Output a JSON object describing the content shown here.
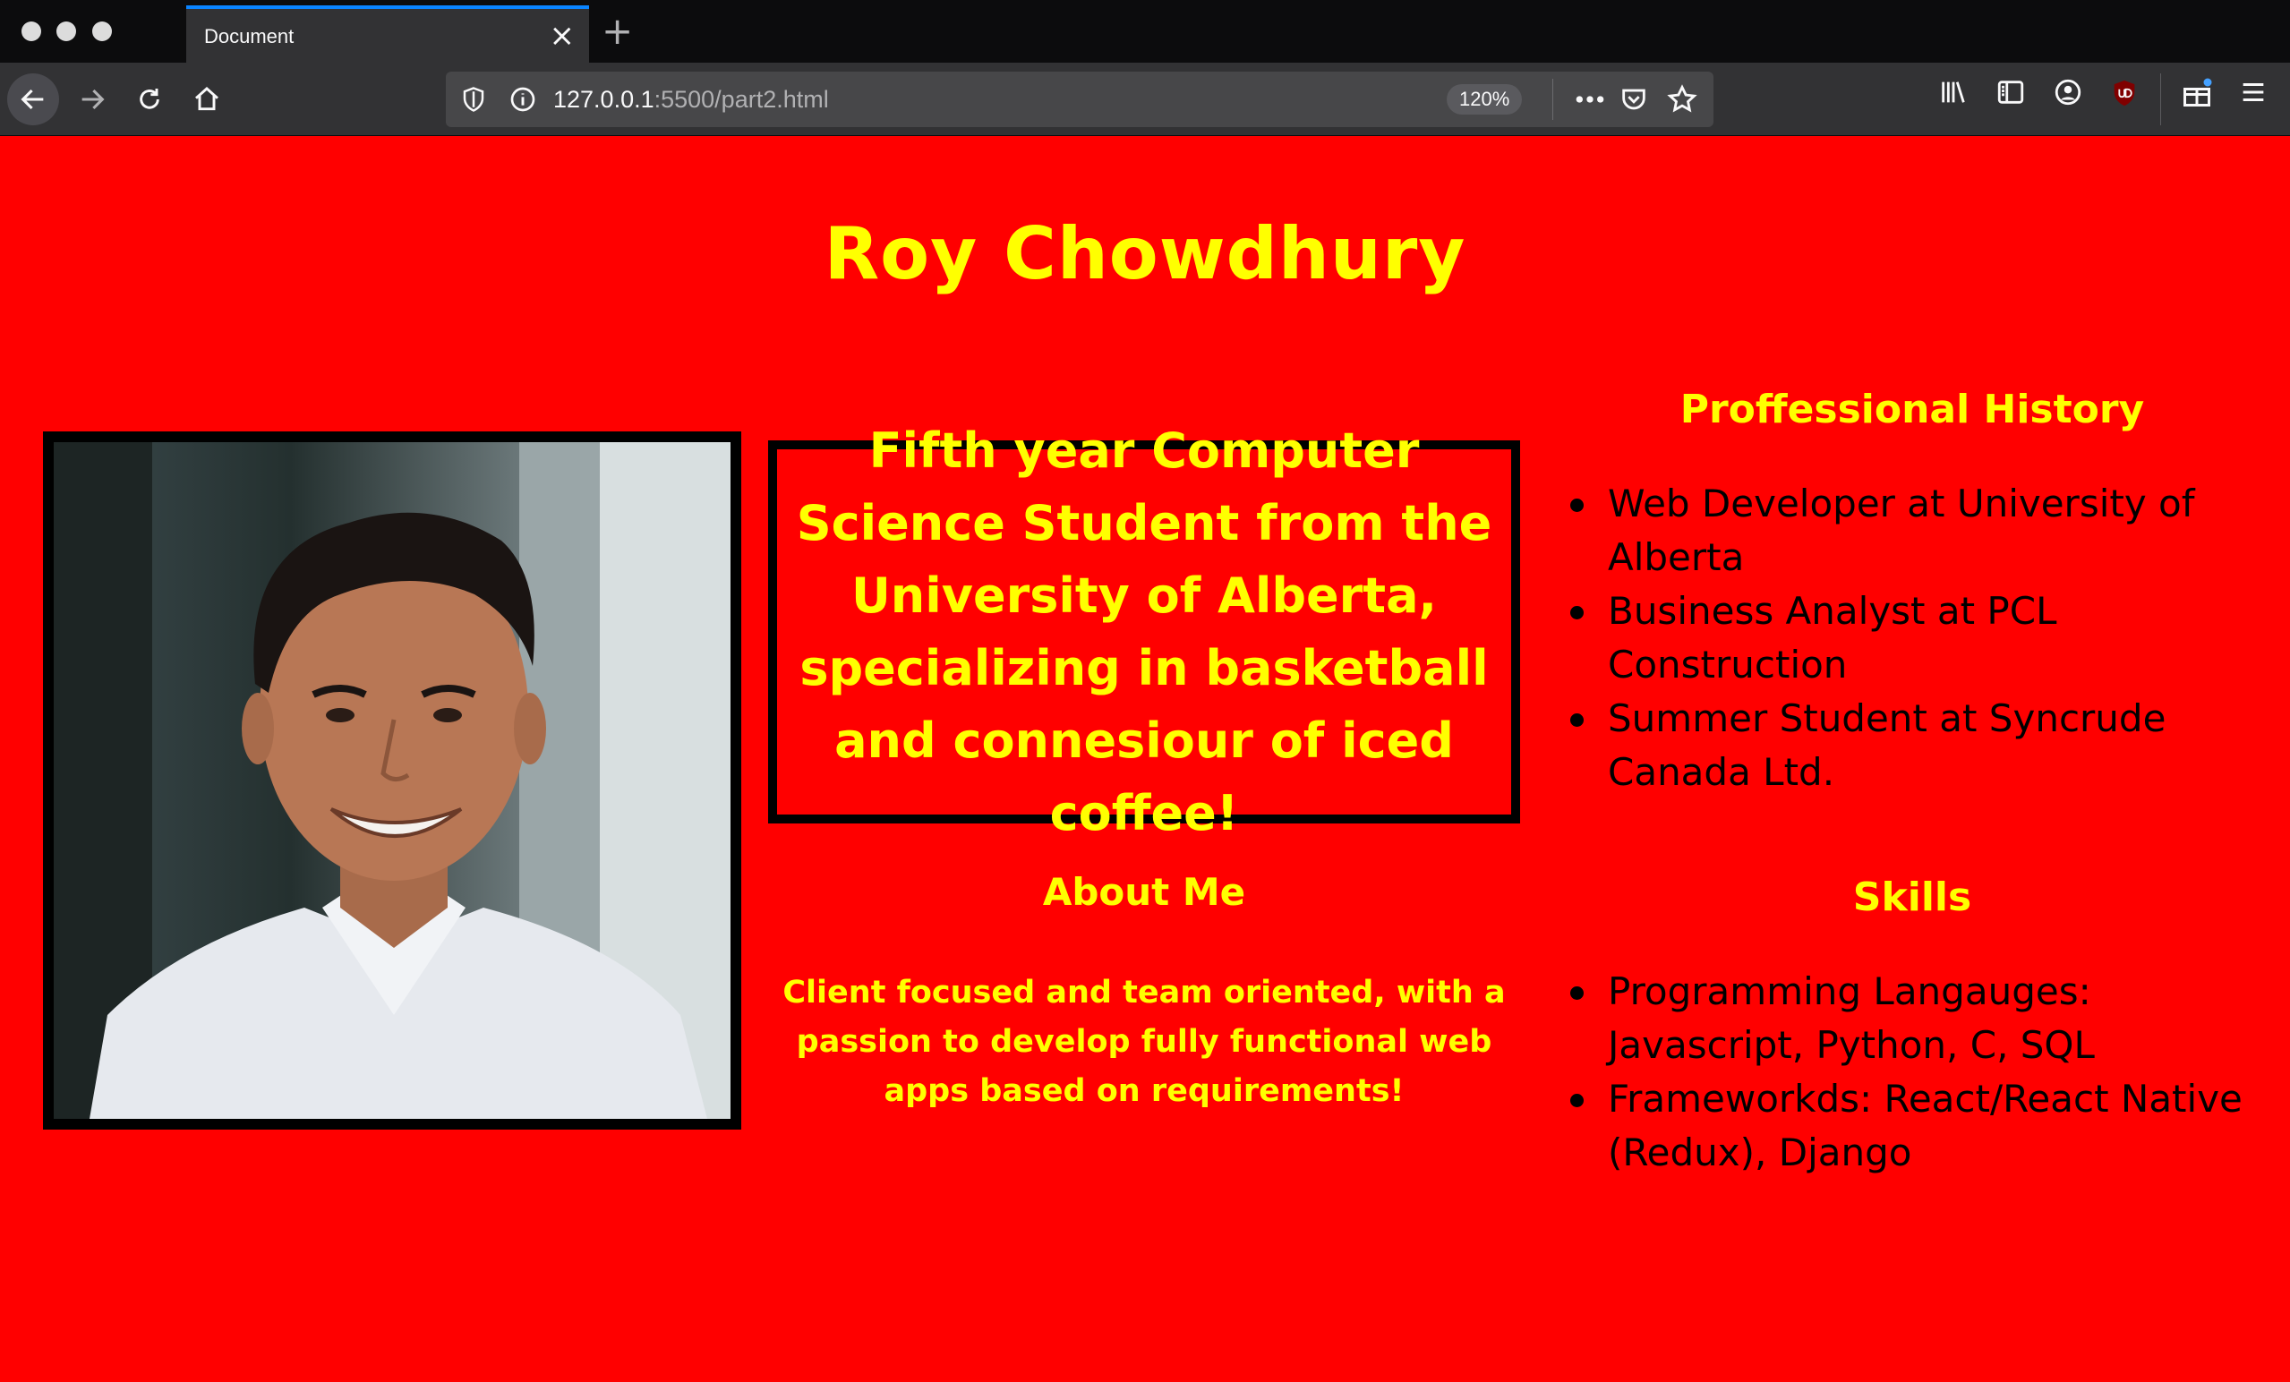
{
  "browser": {
    "tab_title": "Document",
    "url_host": "127.0.0.1",
    "url_rest": ":5500/part2.html",
    "zoom": "120%",
    "accent_color": "#0a84ff"
  },
  "page": {
    "background_color": "#ff0000",
    "heading_color": "#ffff00",
    "name": "Roy Chowdhury",
    "photo": {
      "icon": "portrait-photo"
    },
    "intro": "Fifth year Computer Science Student from the University of Alberta, specializing in basketball and connesiour of iced coffee!",
    "about": {
      "heading": "About Me",
      "body": "Client focused and team oriented, with a passion to develop fully functional web apps based on requirements!"
    },
    "history": {
      "heading": "Proffessional History",
      "items": [
        "Web Developer at University of Alberta",
        "Business Analyst at PCL Construction",
        "Summer Student at Syncrude Canada Ltd."
      ]
    },
    "skills": {
      "heading": "Skills",
      "items": [
        "Programming Langauges: Javascript, Python, C, SQL",
        "Frameworkds: React/React Native (Redux), Django"
      ]
    }
  }
}
